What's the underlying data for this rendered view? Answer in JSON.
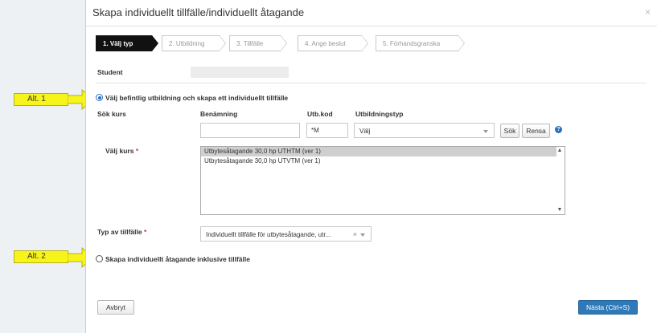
{
  "dialog": {
    "title": "Skapa individuellt tillfälle/individuellt åtagande",
    "close_glyph": "×"
  },
  "steps": [
    {
      "label": "1. Välj typ"
    },
    {
      "label": "2. Utbildning"
    },
    {
      "label": "3. Tillfälle"
    },
    {
      "label": "4. Ange beslut"
    },
    {
      "label": "5. Förhandsgranska"
    }
  ],
  "student_label": "Student",
  "option1": {
    "label": "Välj befintlig utbildning och skapa ett individuellt tillfälle",
    "checked": true
  },
  "search": {
    "sok_kurs_label": "Sök kurs",
    "col_benamning": "Benämning",
    "col_utbkod": "Utb.kod",
    "col_utbildningstyp": "Utbildningstyp",
    "benamning_value": "",
    "utbkod_value": "*M",
    "utbildningstyp_value": "Välj",
    "search_button": "Sök",
    "clear_button": "Rensa",
    "help_glyph": "?"
  },
  "valj_kurs": {
    "label": "Välj kurs",
    "required_mark": "*",
    "options": [
      "Utbytesåtagande 30,0 hp UTHTM (ver 1)",
      "Utbytesåtagande 30,0 hp UTVTM (ver 1)"
    ]
  },
  "typ_av_tillfalle": {
    "label": "Typ av tillfälle",
    "required_mark": "*",
    "value": "Individuellt tillfälle för utbytesåtagande, utr...",
    "clear_glyph": "×"
  },
  "option2": {
    "label": "Skapa individuellt åtagande inklusive tillfälle",
    "checked": false
  },
  "footer": {
    "cancel_button": "Avbryt",
    "next_button": "Nästa (Ctrl+S)"
  },
  "annotations": {
    "alt1": "Alt. 1",
    "alt2": "Alt. 2",
    "callout_color": "#f7f41a"
  }
}
